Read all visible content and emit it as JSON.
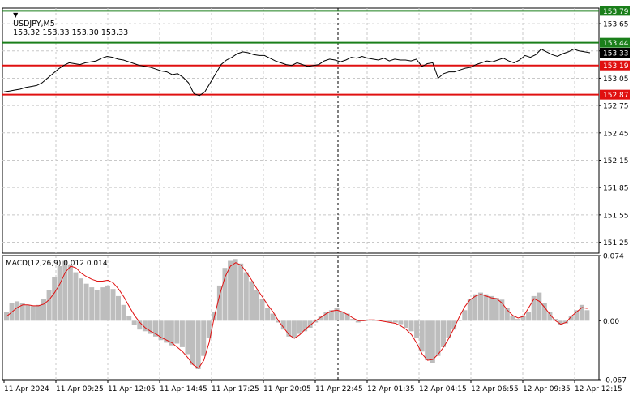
{
  "header": {
    "symbol": "USDJPY,M5",
    "ohlc": "153.32 153.33 153.30 153.33"
  },
  "chart_data": [
    {
      "type": "line",
      "name": "price",
      "ylim": [
        151.13,
        153.82
      ],
      "yticks": [
        "153.65",
        "153.35",
        "153.05",
        "152.75",
        "152.45",
        "152.15",
        "151.85",
        "151.55",
        "151.25"
      ],
      "yticks_values": [
        153.65,
        153.35,
        153.05,
        152.75,
        152.45,
        152.15,
        151.85,
        151.55,
        151.25
      ],
      "grid": true,
      "levels": [
        {
          "value": 153.79,
          "label": "153.79",
          "color": "#1a7f1a"
        },
        {
          "value": 153.44,
          "label": "153.44",
          "color": "#1a7f1a"
        },
        {
          "value": 153.19,
          "label": "153.19",
          "color": "#e01010"
        },
        {
          "value": 152.87,
          "label": "152.87",
          "color": "#e01010"
        }
      ],
      "current_price": {
        "value": 153.33,
        "label": "153.33"
      },
      "series": [
        {
          "values": [
            152.9,
            152.91,
            152.92,
            152.93,
            152.95,
            152.96,
            152.97,
            153.0,
            153.05,
            153.1,
            153.15,
            153.19,
            153.22,
            153.21,
            153.2,
            153.22,
            153.23,
            153.24,
            153.27,
            153.29,
            153.28,
            153.26,
            153.25,
            153.23,
            153.21,
            153.19,
            153.18,
            153.17,
            153.15,
            153.13,
            153.12,
            153.09,
            153.1,
            153.06,
            153.0,
            152.88,
            152.86,
            152.9,
            153.0,
            153.1,
            153.2,
            153.25,
            153.28,
            153.32,
            153.34,
            153.33,
            153.31,
            153.3,
            153.3,
            153.27,
            153.24,
            153.22,
            153.2,
            153.19,
            153.22,
            153.2,
            153.18,
            153.19,
            153.2,
            153.24,
            153.26,
            153.25,
            153.23,
            153.25,
            153.28,
            153.27,
            153.29,
            153.27,
            153.26,
            153.25,
            153.27,
            153.24,
            153.26,
            153.25,
            153.25,
            153.24,
            153.26,
            153.18,
            153.21,
            153.22,
            153.05,
            153.1,
            153.12,
            153.12,
            153.14,
            153.16,
            153.17,
            153.2,
            153.22,
            153.24,
            153.23,
            153.25,
            153.27,
            153.24,
            153.22,
            153.25,
            153.3,
            153.28,
            153.31,
            153.37,
            153.34,
            153.31,
            153.29,
            153.32,
            153.34,
            153.37,
            153.35,
            153.34,
            153.33
          ]
        }
      ]
    },
    {
      "type": "bar",
      "title": "MACD(12,26,9) 0.012 0.014",
      "ylim": [
        -0.067,
        0.074
      ],
      "yticks": [
        "0.074",
        "0.00",
        "-0.067"
      ],
      "yticks_values": [
        0.074,
        0.0,
        -0.067
      ],
      "series": [
        {
          "name": "MACD",
          "values": [
            0.01,
            0.02,
            0.022,
            0.02,
            0.018,
            0.017,
            0.018,
            0.025,
            0.035,
            0.05,
            0.062,
            0.068,
            0.064,
            0.055,
            0.048,
            0.042,
            0.038,
            0.035,
            0.038,
            0.04,
            0.036,
            0.028,
            0.018,
            0.005,
            -0.005,
            -0.01,
            -0.012,
            -0.015,
            -0.018,
            -0.022,
            -0.025,
            -0.028,
            -0.026,
            -0.03,
            -0.038,
            -0.05,
            -0.055,
            -0.04,
            -0.02,
            0.01,
            0.04,
            0.06,
            0.068,
            0.07,
            0.065,
            0.055,
            0.045,
            0.035,
            0.025,
            0.015,
            0.008,
            -0.002,
            -0.01,
            -0.018,
            -0.02,
            -0.015,
            -0.012,
            -0.008,
            -0.002,
            0.005,
            0.01,
            0.012,
            0.015,
            0.01,
            0.008,
            0.002,
            -0.002,
            0.0,
            0.001,
            0.0,
            0.001,
            0.0,
            -0.002,
            -0.002,
            -0.004,
            -0.008,
            -0.012,
            -0.02,
            -0.035,
            -0.045,
            -0.048,
            -0.04,
            -0.03,
            -0.02,
            -0.01,
            0.0,
            0.012,
            0.025,
            0.03,
            0.032,
            0.03,
            0.028,
            0.026,
            0.024,
            0.015,
            0.005,
            0.002,
            0.005,
            0.01,
            0.028,
            0.032,
            0.02,
            0.01,
            0.002,
            -0.005,
            -0.003,
            0.005,
            0.012,
            0.018,
            0.012
          ]
        },
        {
          "name": "Signal",
          "values": [
            0.005,
            0.01,
            0.015,
            0.018,
            0.018,
            0.017,
            0.017,
            0.019,
            0.024,
            0.032,
            0.042,
            0.055,
            0.062,
            0.06,
            0.054,
            0.05,
            0.047,
            0.045,
            0.045,
            0.046,
            0.043,
            0.036,
            0.027,
            0.016,
            0.006,
            -0.002,
            -0.008,
            -0.012,
            -0.015,
            -0.019,
            -0.022,
            -0.025,
            -0.03,
            -0.035,
            -0.042,
            -0.05,
            -0.054,
            -0.045,
            -0.025,
            0.005,
            0.03,
            0.05,
            0.062,
            0.066,
            0.063,
            0.055,
            0.046,
            0.036,
            0.027,
            0.018,
            0.01,
            0.0,
            -0.008,
            -0.016,
            -0.02,
            -0.016,
            -0.01,
            -0.005,
            0.0,
            0.004,
            0.008,
            0.011,
            0.012,
            0.01,
            0.007,
            0.003,
            0.0,
            0.0,
            0.001,
            0.001,
            0.0,
            -0.001,
            -0.002,
            -0.003,
            -0.006,
            -0.01,
            -0.016,
            -0.026,
            -0.038,
            -0.045,
            -0.044,
            -0.038,
            -0.03,
            -0.02,
            -0.008,
            0.005,
            0.016,
            0.024,
            0.028,
            0.03,
            0.028,
            0.026,
            0.025,
            0.02,
            0.012,
            0.006,
            0.003,
            0.005,
            0.015,
            0.025,
            0.022,
            0.015,
            0.007,
            0.0,
            -0.004,
            -0.002,
            0.005,
            0.01,
            0.015,
            0.014
          ]
        }
      ]
    }
  ],
  "xaxis": {
    "ticks": [
      "11 Apr 2024",
      "11 Apr 09:25",
      "11 Apr 12:05",
      "11 Apr 14:45",
      "11 Apr 17:25",
      "11 Apr 20:05",
      "11 Apr 22:45",
      "12 Apr 01:35",
      "12 Apr 04:15",
      "12 Apr 06:55",
      "12 Apr 09:35",
      "12 Apr 12:15"
    ]
  },
  "colors": {
    "background": "#ffffff",
    "grid": "#c8c8c8",
    "price_line": "#000000",
    "support_line": "#e01010",
    "resistance_line": "#1a7f1a",
    "macd_histogram": "#bdbdbd",
    "signal_line": "#e01010",
    "current_price_bg": "#000000",
    "current_price_fg": "#ffffff"
  }
}
